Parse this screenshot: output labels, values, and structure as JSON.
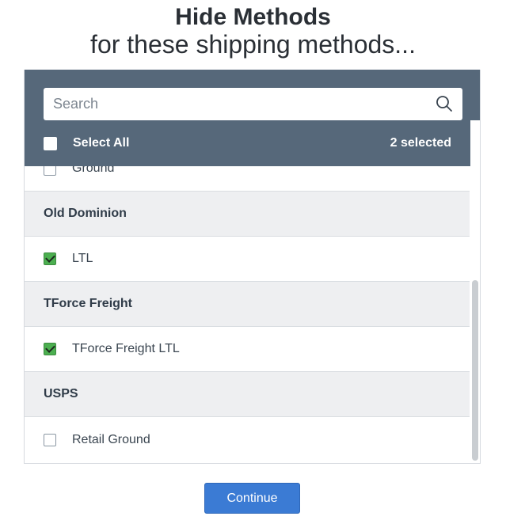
{
  "dialog": {
    "title": "Hide Methods",
    "subtitle": "for these shipping methods..."
  },
  "search": {
    "placeholder": "Search",
    "value": ""
  },
  "header": {
    "select_all_label": "Select All",
    "selected_count": "2 selected",
    "select_all_checked": false
  },
  "list": {
    "rows": [
      {
        "type": "item",
        "label": "Ground",
        "checked": false
      },
      {
        "type": "group",
        "label": "Old Dominion"
      },
      {
        "type": "item",
        "label": "LTL",
        "checked": true
      },
      {
        "type": "group",
        "label": "TForce Freight"
      },
      {
        "type": "item",
        "label": "TForce Freight LTL",
        "checked": true
      },
      {
        "type": "group",
        "label": "USPS"
      },
      {
        "type": "item",
        "label": "Retail Ground",
        "checked": false
      }
    ]
  },
  "footer": {
    "continue_label": "Continue"
  },
  "colors": {
    "header_bg": "#56687a",
    "check_green": "#4caf50",
    "button_blue": "#3b7bd4"
  },
  "icons": {
    "search": "search-icon"
  }
}
